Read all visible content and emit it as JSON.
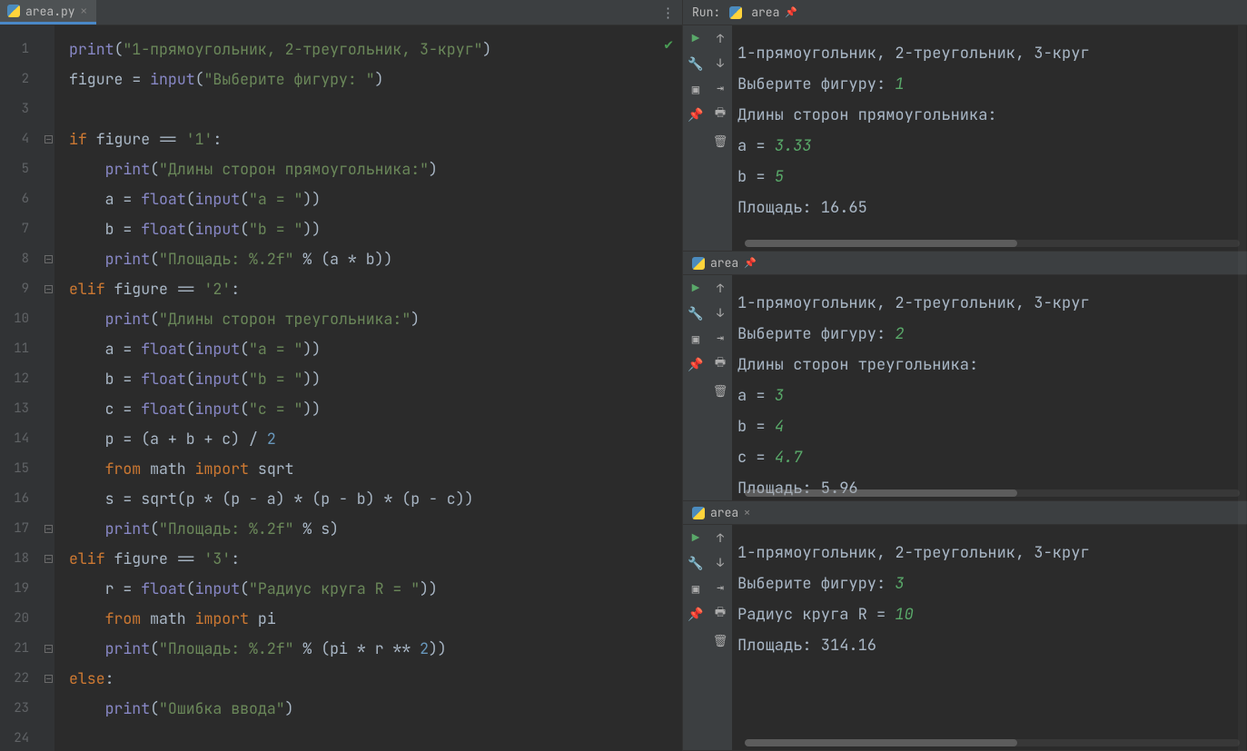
{
  "tab": {
    "name": "area.py"
  },
  "run_label": "Run:",
  "run_target": "area",
  "gutter_lines": [
    "1",
    "2",
    "3",
    "4",
    "5",
    "6",
    "7",
    "8",
    "9",
    "10",
    "11",
    "12",
    "13",
    "14",
    "15",
    "16",
    "17",
    "18",
    "19",
    "20",
    "21",
    "22",
    "23",
    "24"
  ],
  "code": [
    [
      [
        "fn",
        "print"
      ],
      [
        "op",
        "("
      ],
      [
        "str",
        "\"1-прямоугольник, 2-треугольник, 3-круг\""
      ],
      [
        "op",
        ")"
      ]
    ],
    [
      [
        "id",
        "figure "
      ],
      [
        "op",
        "= "
      ],
      [
        "builtin",
        "input"
      ],
      [
        "op",
        "("
      ],
      [
        "str",
        "\"Выберите фигуру: \""
      ],
      [
        "op",
        ")"
      ]
    ],
    [],
    [
      [
        "kw",
        "if "
      ],
      [
        "id",
        "figure "
      ],
      [
        "op",
        "== "
      ],
      [
        "str",
        "'1'"
      ],
      [
        "op",
        ":"
      ]
    ],
    [
      [
        "id",
        "    "
      ],
      [
        "fn",
        "print"
      ],
      [
        "op",
        "("
      ],
      [
        "str",
        "\"Длины сторон прямоугольника:\""
      ],
      [
        "op",
        ")"
      ]
    ],
    [
      [
        "id",
        "    a "
      ],
      [
        "op",
        "= "
      ],
      [
        "builtin",
        "float"
      ],
      [
        "op",
        "("
      ],
      [
        "builtin",
        "input"
      ],
      [
        "op",
        "("
      ],
      [
        "str",
        "\"a = \""
      ],
      [
        "op",
        "))"
      ]
    ],
    [
      [
        "id",
        "    b "
      ],
      [
        "op",
        "= "
      ],
      [
        "builtin",
        "float"
      ],
      [
        "op",
        "("
      ],
      [
        "builtin",
        "input"
      ],
      [
        "op",
        "("
      ],
      [
        "str",
        "\"b = \""
      ],
      [
        "op",
        "))"
      ]
    ],
    [
      [
        "id",
        "    "
      ],
      [
        "fn",
        "print"
      ],
      [
        "op",
        "("
      ],
      [
        "str",
        "\"Площадь: %.2f\""
      ],
      [
        "op",
        " % (a * b))"
      ]
    ],
    [
      [
        "kw",
        "elif "
      ],
      [
        "id",
        "figure "
      ],
      [
        "op",
        "== "
      ],
      [
        "str",
        "'2'"
      ],
      [
        "op",
        ":"
      ]
    ],
    [
      [
        "id",
        "    "
      ],
      [
        "fn",
        "print"
      ],
      [
        "op",
        "("
      ],
      [
        "str",
        "\"Длины сторон треугольника:\""
      ],
      [
        "op",
        ")"
      ]
    ],
    [
      [
        "id",
        "    a "
      ],
      [
        "op",
        "= "
      ],
      [
        "builtin",
        "float"
      ],
      [
        "op",
        "("
      ],
      [
        "builtin",
        "input"
      ],
      [
        "op",
        "("
      ],
      [
        "str",
        "\"a = \""
      ],
      [
        "op",
        "))"
      ]
    ],
    [
      [
        "id",
        "    b "
      ],
      [
        "op",
        "= "
      ],
      [
        "builtin",
        "float"
      ],
      [
        "op",
        "("
      ],
      [
        "builtin",
        "input"
      ],
      [
        "op",
        "("
      ],
      [
        "str",
        "\"b = \""
      ],
      [
        "op",
        "))"
      ]
    ],
    [
      [
        "id",
        "    c "
      ],
      [
        "op",
        "= "
      ],
      [
        "builtin",
        "float"
      ],
      [
        "op",
        "("
      ],
      [
        "builtin",
        "input"
      ],
      [
        "op",
        "("
      ],
      [
        "str",
        "\"c = \""
      ],
      [
        "op",
        "))"
      ]
    ],
    [
      [
        "id",
        "    p "
      ],
      [
        "op",
        "= (a + b + c) / "
      ],
      [
        "num",
        "2"
      ]
    ],
    [
      [
        "id",
        "    "
      ],
      [
        "kw",
        "from "
      ],
      [
        "id",
        "math "
      ],
      [
        "kw",
        "import "
      ],
      [
        "id",
        "sqrt"
      ]
    ],
    [
      [
        "id",
        "    s "
      ],
      [
        "op",
        "= sqrt(p * (p - a) * (p - b) * (p - c))"
      ]
    ],
    [
      [
        "id",
        "    "
      ],
      [
        "fn",
        "print"
      ],
      [
        "op",
        "("
      ],
      [
        "str",
        "\"Площадь: %.2f\""
      ],
      [
        "op",
        " % s)"
      ]
    ],
    [
      [
        "kw",
        "elif "
      ],
      [
        "id",
        "figure "
      ],
      [
        "op",
        "== "
      ],
      [
        "str",
        "'3'"
      ],
      [
        "op",
        ":"
      ]
    ],
    [
      [
        "id",
        "    r "
      ],
      [
        "op",
        "= "
      ],
      [
        "builtin",
        "float"
      ],
      [
        "op",
        "("
      ],
      [
        "builtin",
        "input"
      ],
      [
        "op",
        "("
      ],
      [
        "str",
        "\"Радиус круга R = \""
      ],
      [
        "op",
        "))"
      ]
    ],
    [
      [
        "id",
        "    "
      ],
      [
        "kw",
        "from "
      ],
      [
        "id",
        "math "
      ],
      [
        "kw",
        "import "
      ],
      [
        "id",
        "pi"
      ]
    ],
    [
      [
        "id",
        "    "
      ],
      [
        "fn",
        "print"
      ],
      [
        "op",
        "("
      ],
      [
        "str",
        "\"Площадь: %.2f\""
      ],
      [
        "op",
        " % (pi * r ** "
      ],
      [
        "num",
        "2"
      ],
      [
        "op",
        "))"
      ]
    ],
    [
      [
        "kw",
        "else"
      ],
      [
        "op",
        ":"
      ]
    ],
    [
      [
        "id",
        "    "
      ],
      [
        "fn",
        "print"
      ],
      [
        "op",
        "("
      ],
      [
        "str",
        "\"Ошибка ввода\""
      ],
      [
        "op",
        ")"
      ]
    ],
    []
  ],
  "fold_rows": [
    4,
    8,
    9,
    17,
    18,
    21,
    22
  ],
  "runs": [
    {
      "title": "area",
      "lines": [
        [
          [
            "out",
            "1-прямоугольник, 2-треугольник, 3-круг"
          ]
        ],
        [
          [
            "out",
            "Выберите фигуру: "
          ],
          [
            "inp",
            "1"
          ]
        ],
        [
          [
            "out",
            "Длины сторон прямоугольника:"
          ]
        ],
        [
          [
            "out",
            "a = "
          ],
          [
            "inp",
            "3.33"
          ]
        ],
        [
          [
            "out",
            "b = "
          ],
          [
            "inp",
            "5"
          ]
        ],
        [
          [
            "out",
            "Площадь: 16.65"
          ]
        ]
      ]
    },
    {
      "title": "area",
      "lines": [
        [
          [
            "out",
            "1-прямоугольник, 2-треугольник, 3-круг"
          ]
        ],
        [
          [
            "out",
            "Выберите фигуру: "
          ],
          [
            "inp",
            "2"
          ]
        ],
        [
          [
            "out",
            "Длины сторон треугольника:"
          ]
        ],
        [
          [
            "out",
            "a = "
          ],
          [
            "inp",
            "3"
          ]
        ],
        [
          [
            "out",
            "b = "
          ],
          [
            "inp",
            "4"
          ]
        ],
        [
          [
            "out",
            "c = "
          ],
          [
            "inp",
            "4.7"
          ]
        ],
        [
          [
            "out",
            "Площадь: 5.96"
          ]
        ]
      ]
    },
    {
      "title": "area",
      "lines": [
        [
          [
            "out",
            "1-прямоугольник, 2-треугольник, 3-круг"
          ]
        ],
        [
          [
            "out",
            "Выберите фигуру: "
          ],
          [
            "inp",
            "3"
          ]
        ],
        [
          [
            "out",
            "Радиус круга R = "
          ],
          [
            "inp",
            "10"
          ]
        ],
        [
          [
            "out",
            "Площадь: 314.16"
          ]
        ]
      ]
    }
  ]
}
